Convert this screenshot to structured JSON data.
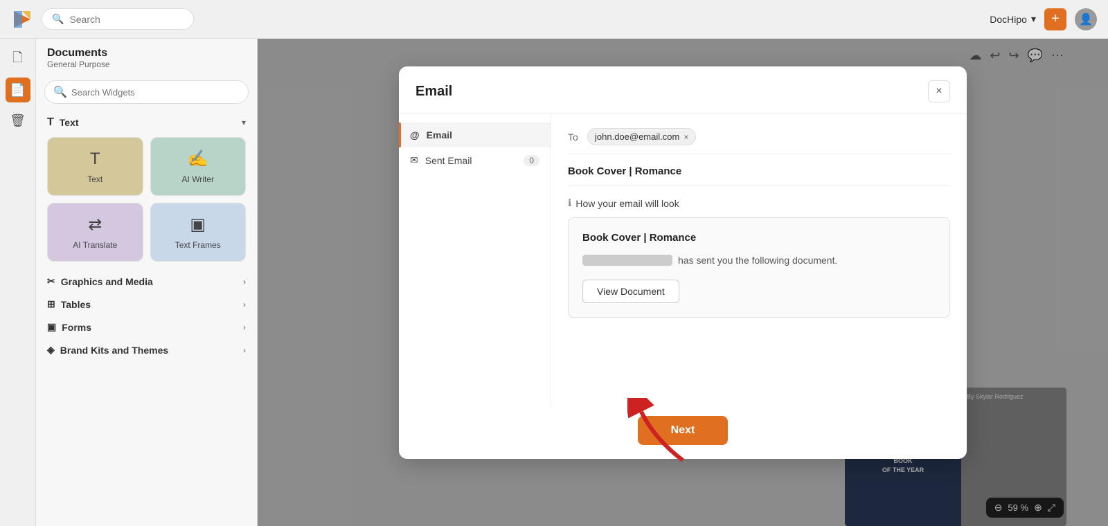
{
  "app": {
    "logo_text": "▶",
    "search_placeholder": "Search",
    "brand_name": "DocHipo",
    "brand_arrow": "▾",
    "plus_icon": "+",
    "user_icon": "👤"
  },
  "topbar_icons": {
    "cloud": "☁",
    "undo": "↩",
    "redo": "↪",
    "comment": "💬",
    "more": "⋯"
  },
  "left_panel": {
    "title": "Documents",
    "subtitle": "General Purpose",
    "search_placeholder": "Search Widgets",
    "sections": [
      {
        "id": "text",
        "icon": "T",
        "label": "Text",
        "expanded": true
      },
      {
        "id": "graphics",
        "icon": "✂",
        "label": "Graphics and Media",
        "expanded": false
      },
      {
        "id": "tables",
        "icon": "⊞",
        "label": "Tables",
        "expanded": false
      },
      {
        "id": "forms",
        "icon": "▣",
        "label": "Forms",
        "expanded": false
      },
      {
        "id": "brand",
        "icon": "◈",
        "label": "Brand Kits and Themes",
        "expanded": false
      }
    ],
    "widgets": [
      {
        "label": "Text",
        "icon": "T"
      },
      {
        "label": "AI Writer",
        "icon": "✍"
      },
      {
        "label": "AI Translate",
        "icon": "⇄"
      },
      {
        "label": "Text Frames",
        "icon": "▣"
      }
    ]
  },
  "modal": {
    "title": "Email",
    "close_label": "×",
    "sidebar_items": [
      {
        "id": "email",
        "icon": "@",
        "label": "Email",
        "active": true,
        "badge": null
      },
      {
        "id": "sent",
        "icon": "✉",
        "label": "Sent Email",
        "active": false,
        "badge": "0"
      }
    ],
    "to_label": "To",
    "to_email": "john.doe@email.com",
    "subject": "Book Cover | Romance",
    "preview_label": "How your email will look",
    "preview_info_icon": "ℹ",
    "preview": {
      "title": "Book Cover | Romance",
      "placeholder_text": "",
      "sent_text": "has sent you the following document.",
      "view_button": "View Document"
    },
    "next_button": "Next"
  },
  "zoom": {
    "minus": "⊖",
    "value": "59 %",
    "plus": "⊕",
    "fullscreen": "⤢"
  },
  "bg_book": {
    "title": "BEST\nROMANTIC\nBOOK\nOF THE YEAR",
    "author": "By Skylar Rodriguez"
  }
}
